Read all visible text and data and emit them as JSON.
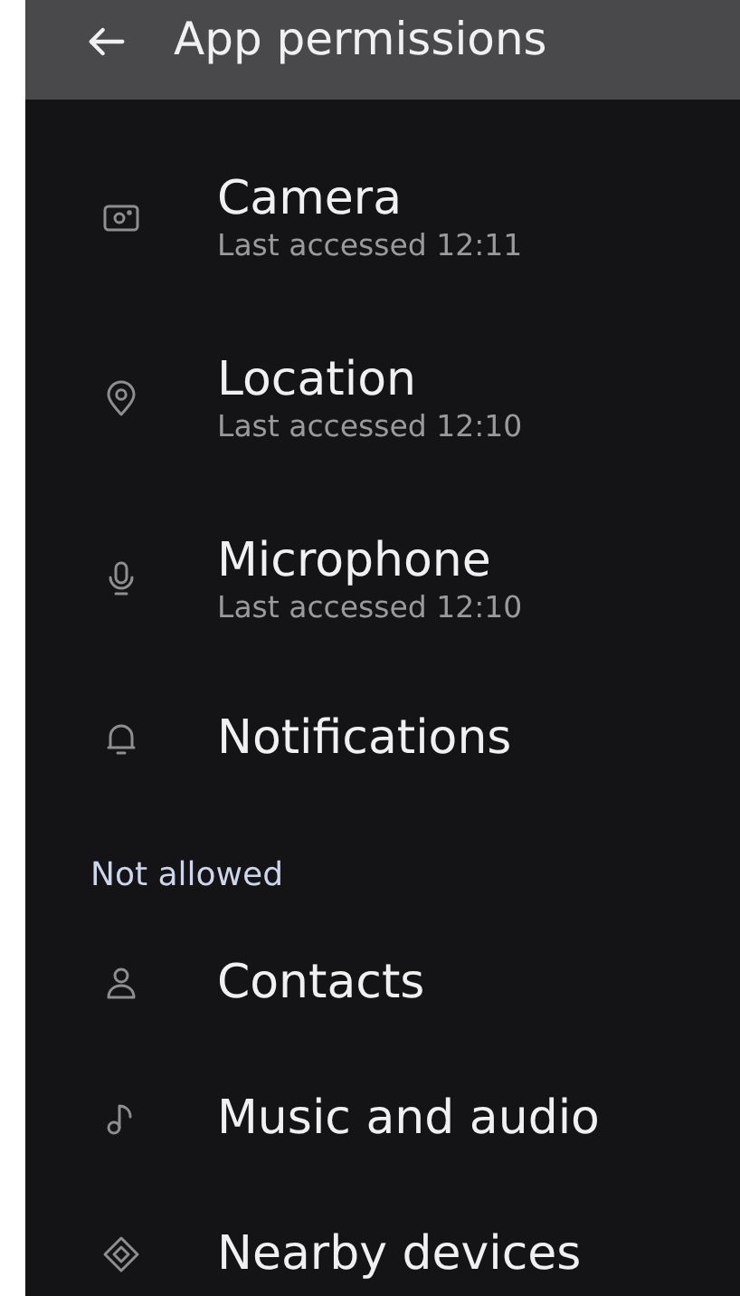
{
  "app_bar": {
    "title": "App permissions"
  },
  "sections": [
    {
      "items": [
        {
          "label": "Camera",
          "subtitle": "Last accessed 12:11"
        },
        {
          "label": "Location",
          "subtitle": "Last accessed 12:10"
        },
        {
          "label": "Microphone",
          "subtitle": "Last accessed 12:10"
        },
        {
          "label": "Notifications"
        }
      ]
    },
    {
      "header": "Not allowed",
      "items": [
        {
          "label": "Contacts"
        },
        {
          "label": "Music and audio"
        },
        {
          "label": "Nearby devices"
        }
      ]
    }
  ]
}
